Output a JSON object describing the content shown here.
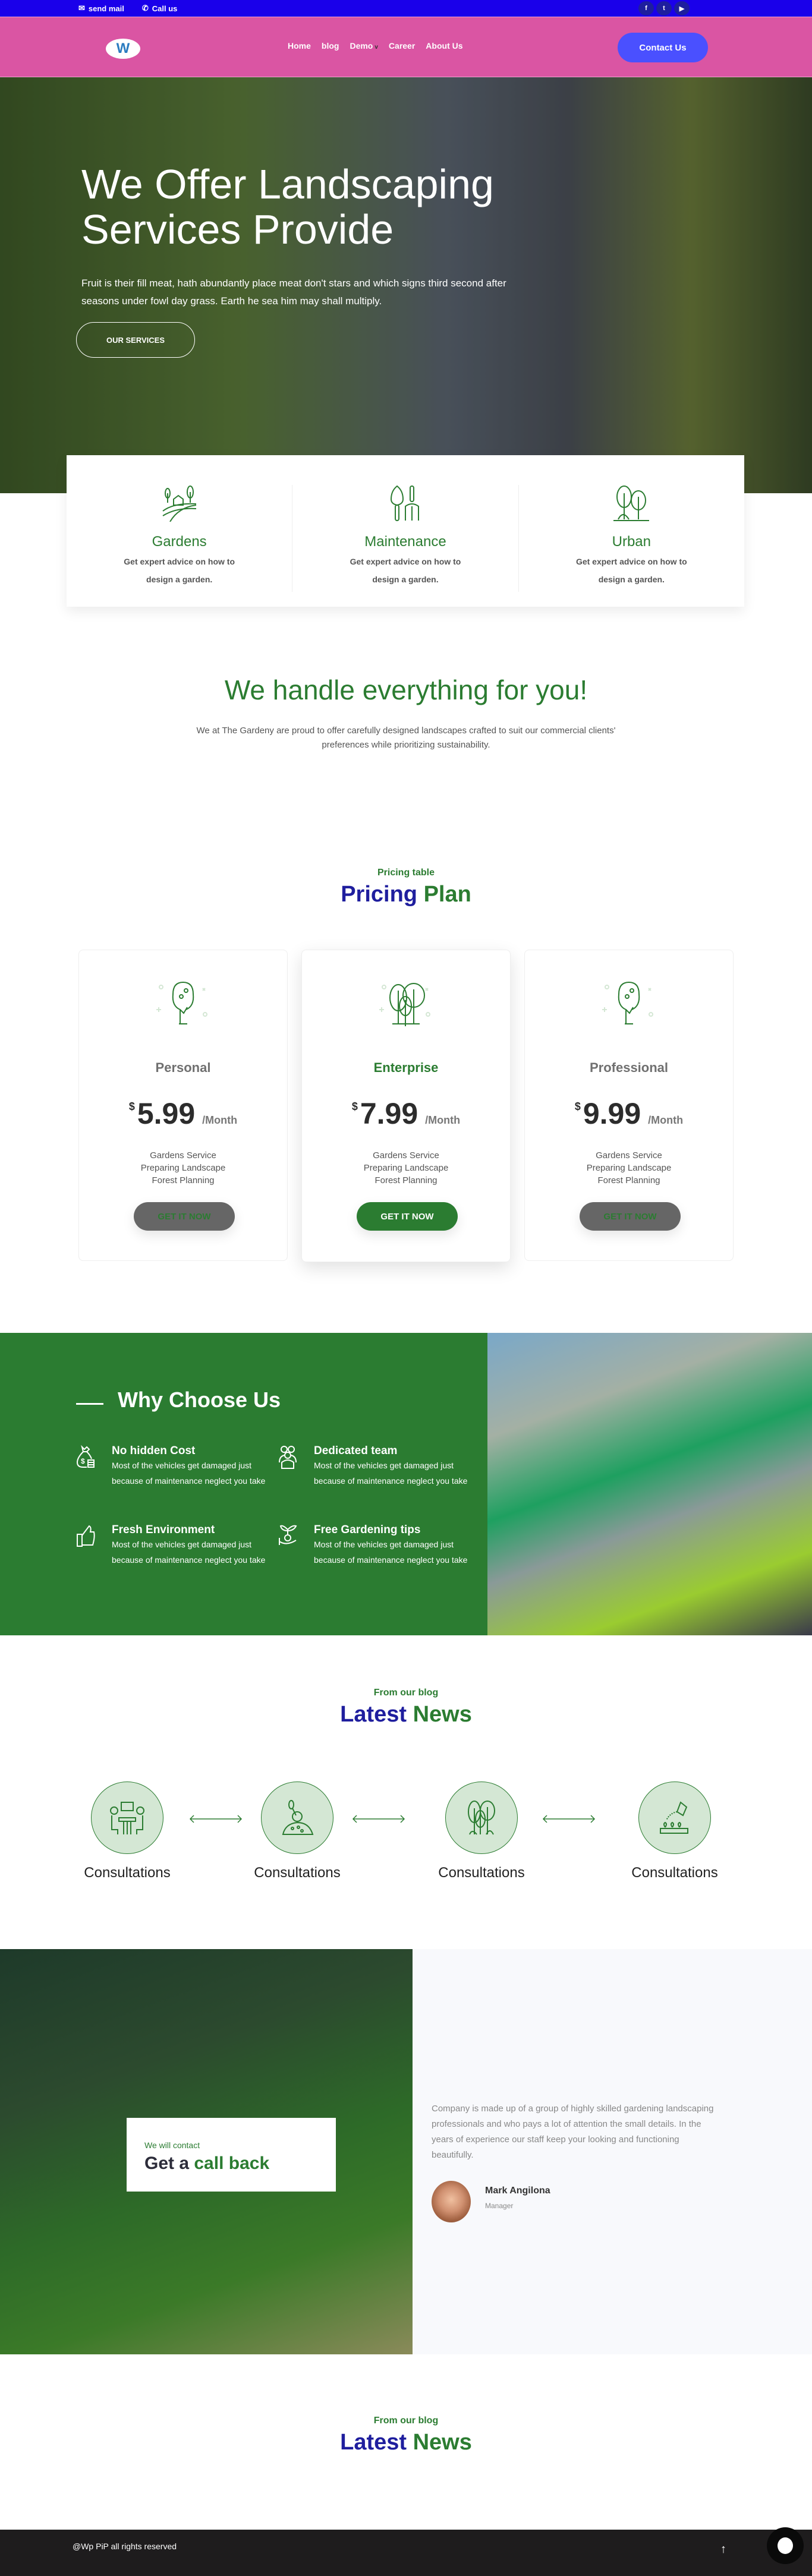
{
  "topbar": {
    "mail_label": "send mail",
    "call_label": "Call us",
    "social": [
      {
        "icon": "facebook-icon",
        "glyph": "f"
      },
      {
        "icon": "twitter-icon",
        "glyph": "t"
      },
      {
        "icon": "youtube-icon",
        "glyph": "▶"
      }
    ]
  },
  "nav": {
    "logo_letter": "W",
    "items": [
      "Home",
      "blog",
      "Demo",
      "Career",
      "About Us"
    ],
    "dropdown_chevron": "v",
    "contact_button": "Contact Us"
  },
  "hero": {
    "title": "We Offer Landscaping Services Provide",
    "description": "Fruit is their fill meat, hath abundantly place meat don't stars and which signs third second after seasons under fowl day grass. Earth he sea him may shall multiply.",
    "button": "OUR SERVICES"
  },
  "services": [
    {
      "icon": "garden-farm-icon",
      "title": "Gardens",
      "text": "Get expert advice on how to design a garden."
    },
    {
      "icon": "garden-tools-icon",
      "title": "Maintenance",
      "text": "Get expert advice on how to design a garden."
    },
    {
      "icon": "trees-icon",
      "title": "Urban",
      "text": "Get expert advice on how to design a garden."
    }
  ],
  "handle": {
    "title": "We handle everything for you!",
    "text": "We at The Gardeny are proud to offer carefully designed landscapes crafted to suit our commercial clients' preferences while prioritizing sustainability."
  },
  "pricing": {
    "subtitle": "Pricing table",
    "title_a": "Pricing",
    "title_b": "Plan",
    "plans": [
      {
        "name": "Personal",
        "currency": "$",
        "amount": "5.99",
        "period": "/Month",
        "features": [
          "Gardens Service",
          "Preparing Landscape",
          "Forest Planning"
        ],
        "button": "GET IT NOW"
      },
      {
        "name": "Enterprise",
        "currency": "$",
        "amount": "7.99",
        "period": "/Month",
        "features": [
          "Gardens Service",
          "Preparing Landscape",
          "Forest Planning"
        ],
        "button": "GET IT NOW"
      },
      {
        "name": "Professional",
        "currency": "$",
        "amount": "9.99",
        "period": "/Month",
        "features": [
          "Gardens Service",
          "Preparing Landscape",
          "Forest Planning"
        ],
        "button": "GET IT NOW"
      }
    ]
  },
  "why": {
    "title": "Why Choose Us",
    "items": [
      {
        "icon": "money-bag-icon",
        "title": "No hidden Cost",
        "text": "Most of the vehicles get damaged just because of maintenance neglect you take"
      },
      {
        "icon": "team-icon",
        "title": "Dedicated team",
        "text": "Most of the vehicles get damaged just because of maintenance neglect you take"
      },
      {
        "icon": "thumbs-up-icon",
        "title": "Fresh Environment",
        "text": "Most of the vehicles get damaged just because of maintenance neglect you take"
      },
      {
        "icon": "plant-in-hand-icon",
        "title": "Free Gardening tips",
        "text": "Most of the vehicles get damaged just because of maintenance neglect you take"
      }
    ]
  },
  "news": {
    "subtitle": "From our blog",
    "title_a": "Latest",
    "title_b": "News",
    "steps": [
      {
        "icon": "consultation-icon",
        "label": "Consultations"
      },
      {
        "icon": "soil-shovel-icon",
        "label": "Consultations"
      },
      {
        "icon": "trees-icon",
        "label": "Consultations"
      },
      {
        "icon": "watering-can-icon",
        "label": "Consultations"
      }
    ]
  },
  "callback": {
    "subtitle": "We will contact",
    "title_a": "Get a ",
    "title_b": "call back"
  },
  "testimonial": {
    "text": "Company is made up of a group of highly skilled gardening landscaping professionals and who pays a lot of attention the small details. In the years of experience our staff keep your looking and functioning beautifully.",
    "name": "Mark Angilona",
    "role": "Manager"
  },
  "news2": {
    "subtitle": "From our blog",
    "title_a": "Latest",
    "title_b": "News"
  },
  "footer": {
    "copyright": "@Wp PiP all rights reserved",
    "scroll_top": "↑"
  },
  "colors": {
    "topbar": "#1a00ea",
    "nav": "#da55a3",
    "contact_button": "#4a50ff",
    "brand_green": "#2b7c31",
    "title_blue": "#1f1e9e",
    "footer": "#1e1c1d"
  }
}
